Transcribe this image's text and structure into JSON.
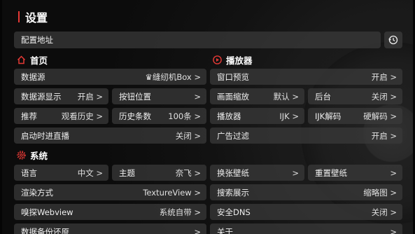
{
  "title": "设置",
  "config_address": {
    "label": "配置地址"
  },
  "sections": {
    "home": "首页",
    "player": "播放器",
    "system": "系统"
  },
  "rows": {
    "datasource": {
      "label": "数据源",
      "value": "♛缝纫机Box >"
    },
    "datasource_display": {
      "label": "数据源显示",
      "value": "开启 >"
    },
    "button_position": {
      "label": "按钮位置",
      "value": ">"
    },
    "recommend": {
      "label": "推荐",
      "value": "观看历史 >"
    },
    "history_count": {
      "label": "历史条数",
      "value": "100条 >"
    },
    "startup_live": {
      "label": "启动时进直播",
      "value": "关闭 >"
    },
    "window_preview": {
      "label": "窗口预览",
      "value": "开启 >"
    },
    "screen_scale": {
      "label": "画面缩放",
      "value": "默认 >"
    },
    "background": {
      "label": "后台",
      "value": "关闭 >"
    },
    "player": {
      "label": "播放器",
      "value": "IJK >"
    },
    "ijk_decode": {
      "label": "IJK解码",
      "value": "硬解码 >"
    },
    "ad_filter": {
      "label": "广告过滤",
      "value": "开启 >"
    },
    "language": {
      "label": "语言",
      "value": "中文 >"
    },
    "theme": {
      "label": "主题",
      "value": "奈飞 >"
    },
    "change_wallpaper": {
      "label": "换张壁纸",
      "value": ">"
    },
    "reset_wallpaper": {
      "label": "重置壁纸",
      "value": ">"
    },
    "render_mode": {
      "label": "渲染方式",
      "value": "TextureView >"
    },
    "search_display": {
      "label": "搜索展示",
      "value": "缩略图 >"
    },
    "sniff_webview": {
      "label": "嗅探Webview",
      "value": "系统自带 >"
    },
    "secure_dns": {
      "label": "安全DNS",
      "value": "关闭 >"
    },
    "backup_restore": {
      "label": "数据备份还原",
      "value": ">"
    },
    "about": {
      "label": "关于",
      "value": ">"
    }
  },
  "colors": {
    "accent": "#e53935",
    "row_bg": "#3a3a3a"
  },
  "icons": {
    "history": "history-icon",
    "home": "home-icon",
    "player": "play-circle-icon",
    "system": "gear-icon"
  }
}
